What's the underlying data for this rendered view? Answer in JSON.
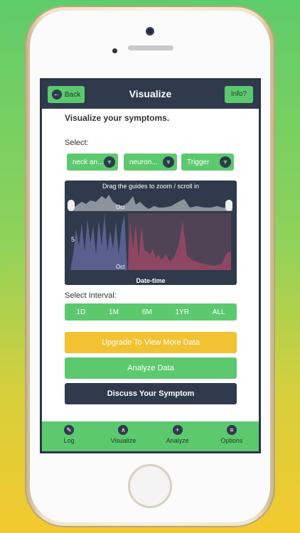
{
  "nav": {
    "title": "Visualize",
    "back_label": "Back",
    "info_label": "Info?"
  },
  "page": {
    "heading": "Visualize your symptoms.",
    "select_label": "Select:",
    "dropdowns": [
      "neck an...",
      "neuron...",
      "Trigger"
    ],
    "interval_label": "Select Interval:",
    "intervals": [
      "1D",
      "1M",
      "6M",
      "1YR",
      "ALL"
    ],
    "buttons": {
      "upgrade": "Upgrade To View More Data",
      "analyze": "Analyze Data",
      "discuss": "Discuss Your Symptom"
    }
  },
  "chart": {
    "hint": "Drag the guides to zoom / scroll in",
    "y_tick": "5",
    "month_tick_top": "Oct",
    "month_tick_main": "Oct",
    "x_label": "Date-time"
  },
  "tabs": [
    "Log",
    "Visualize",
    "Analyze",
    "Options"
  ],
  "colors": {
    "accent": "#5cc96e",
    "dark": "#2f3a4c",
    "upgrade": "#f1c232",
    "series_a": "#5a5f8e",
    "series_b": "#8e4763"
  }
}
